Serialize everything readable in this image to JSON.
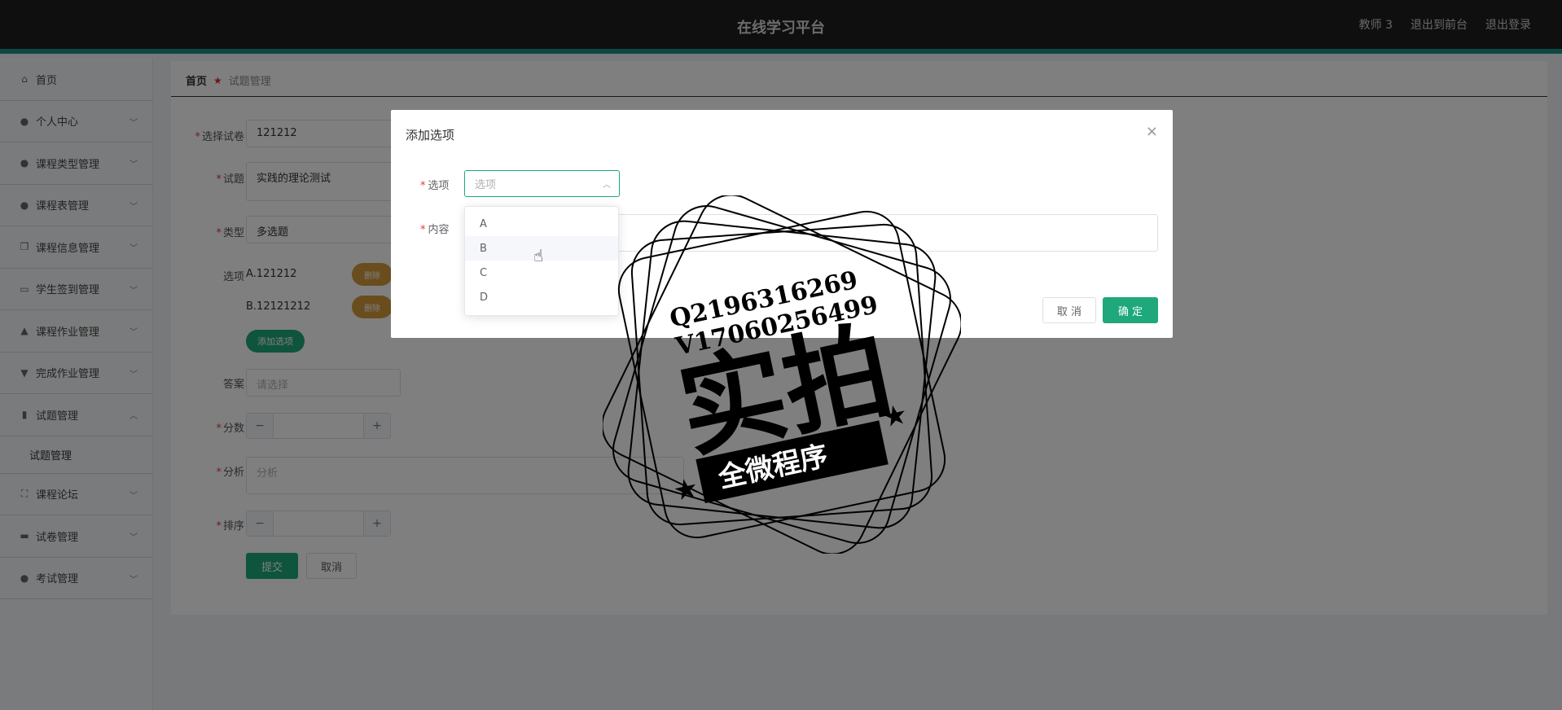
{
  "header": {
    "title": "在线学习平台",
    "links": [
      "教师 3",
      "退出到前台",
      "退出登录"
    ]
  },
  "sidebar": {
    "items": [
      {
        "label": "首页",
        "icon": "home-icon"
      },
      {
        "label": "个人中心",
        "icon": "user-icon"
      },
      {
        "label": "课程类型管理",
        "icon": "user-icon"
      },
      {
        "label": "课程表管理",
        "icon": "user-icon"
      },
      {
        "label": "课程信息管理",
        "icon": "copy-icon"
      },
      {
        "label": "学生签到管理",
        "icon": "chat-icon"
      },
      {
        "label": "课程作业管理",
        "icon": "like-icon"
      },
      {
        "label": "完成作业管理",
        "icon": "stamp-icon"
      },
      {
        "label": "试题管理",
        "icon": "clipboard-icon"
      },
      {
        "label": "课程论坛",
        "icon": "frame-icon"
      },
      {
        "label": "试卷管理",
        "icon": "message-icon"
      },
      {
        "label": "考试管理",
        "icon": "location-icon"
      }
    ],
    "subitem": "试题管理"
  },
  "breadcrumb": {
    "home": "首页",
    "current": "试题管理"
  },
  "form": {
    "paper_label": "选择试卷",
    "paper_value": "121212",
    "question_label": "试题",
    "question_value": "实践的理论测试",
    "type_label": "类型",
    "type_value": "多选题",
    "options_label": "选项",
    "option_a": "A.121212",
    "option_b": "B.12121212",
    "delete_label": "删除",
    "add_option_label": "添加选项",
    "answer_label": "答案",
    "answer_placeholder": "请选择",
    "score_label": "分数",
    "analysis_label": "分析",
    "analysis_placeholder": "分析",
    "sort_label": "排序",
    "submit_label": "提交",
    "cancel_label": "取消"
  },
  "dialog": {
    "title": "添加选项",
    "option_label": "选项",
    "option_placeholder": "选项",
    "content_label": "内容",
    "cancel_label": "取 消",
    "ok_label": "确 定",
    "dropdown_options": [
      "A",
      "B",
      "C",
      "D"
    ],
    "hovered_option": "B"
  },
  "watermark": {
    "line1": "Q2196316269",
    "line2": "V17060256499",
    "main": "实拍",
    "banner": "全微程序"
  },
  "colors": {
    "accent": "#1ea87b",
    "topbar": "#1f1f1f",
    "topbar_border": "#1f8f89",
    "delete": "#d49a3a"
  }
}
